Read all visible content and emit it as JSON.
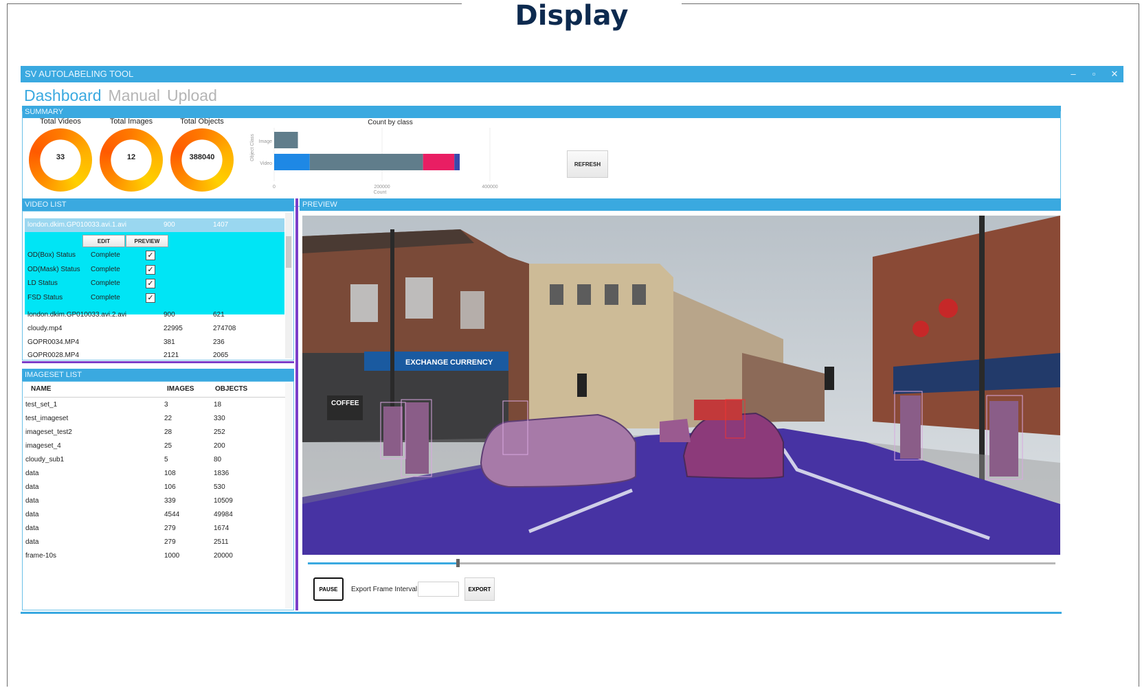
{
  "slide_title": "Display",
  "app": {
    "title": "SV AUTOLABELING TOOL",
    "window_controls": [
      "–",
      "▫",
      "✕"
    ],
    "nav_tabs": [
      {
        "label": "Dashboard",
        "active": true
      },
      {
        "label": "Manual",
        "active": false
      },
      {
        "label": "Upload",
        "active": false
      }
    ],
    "accent_color": "#3aa9e0"
  },
  "summary": {
    "header": "SUMMARY",
    "donuts": [
      {
        "label": "Total Videos",
        "value": "33"
      },
      {
        "label": "Total Images",
        "value": "12"
      },
      {
        "label": "Total Objects",
        "value": "388040"
      }
    ],
    "refresh_label": "REFRESH"
  },
  "chart_data": {
    "type": "bar",
    "orientation": "horizontal",
    "stacked": true,
    "title": "Count by class",
    "xlabel": "Count",
    "ylabel": "Object Class",
    "categories": [
      "Image",
      "Video"
    ],
    "xlim": [
      0,
      400000
    ],
    "xticks": [
      0,
      200000,
      400000
    ],
    "series": [
      {
        "color": "#1e88e5",
        "values": [
          0,
          66000
        ]
      },
      {
        "color": "#607d8b",
        "values": [
          44000,
          210000
        ]
      },
      {
        "color": "#e91e63",
        "values": [
          0,
          58000
        ]
      },
      {
        "color": "#3949ab",
        "values": [
          0,
          10000
        ]
      }
    ]
  },
  "video_list": {
    "header": "VIDEO LIST",
    "selected": {
      "name": "london.dkim.GP010033.avi.1.avi",
      "frames": "900",
      "objects": "1407"
    },
    "edit_label": "EDIT",
    "preview_label": "PREVIEW",
    "statuses": [
      {
        "label": "OD(Box) Status",
        "value": "Complete",
        "check": "✓"
      },
      {
        "label": "OD(Mask) Status",
        "value": "Complete",
        "check": "✓"
      },
      {
        "label": "LD Status",
        "value": "Complete",
        "check": "✓"
      },
      {
        "label": "FSD Status",
        "value": "Complete",
        "check": "✓"
      }
    ],
    "rows": [
      {
        "name": "london.dkim.GP010033.avi.2.avi",
        "frames": "900",
        "objects": "621"
      },
      {
        "name": "cloudy.mp4",
        "frames": "22995",
        "objects": "274708"
      },
      {
        "name": "GOPR0034.MP4",
        "frames": "381",
        "objects": "236"
      },
      {
        "name": "GOPR0028.MP4",
        "frames": "2121",
        "objects": "2065"
      }
    ]
  },
  "imageset_list": {
    "header": "IMAGESET LIST",
    "columns": [
      "NAME",
      "IMAGES",
      "OBJECTS"
    ],
    "rows": [
      {
        "name": "test_set_1",
        "images": "3",
        "objects": "18"
      },
      {
        "name": "test_imageset",
        "images": "22",
        "objects": "330"
      },
      {
        "name": "imageset_test2",
        "images": "28",
        "objects": "252"
      },
      {
        "name": "imageset_4",
        "images": "25",
        "objects": "200"
      },
      {
        "name": "cloudy_sub1",
        "images": "5",
        "objects": "80"
      },
      {
        "name": "data",
        "images": "108",
        "objects": "1836"
      },
      {
        "name": "data",
        "images": "106",
        "objects": "530"
      },
      {
        "name": "data",
        "images": "339",
        "objects": "10509"
      },
      {
        "name": "data",
        "images": "4544",
        "objects": "49984"
      },
      {
        "name": "data",
        "images": "279",
        "objects": "1674"
      },
      {
        "name": "data",
        "images": "279",
        "objects": "2511"
      },
      {
        "name": "frame-10s",
        "images": "1000",
        "objects": "20000"
      }
    ]
  },
  "preview": {
    "header": "PREVIEW",
    "shop_sign": "COFFEE",
    "exchange_sign": "EXCHANGE",
    "currency_sign": "CURRENCY",
    "playback_progress": 0.2,
    "pause_label": "PAUSE",
    "export_interval_label": "Export Frame Interval",
    "export_interval_value": "",
    "export_label": "EXPORT"
  }
}
